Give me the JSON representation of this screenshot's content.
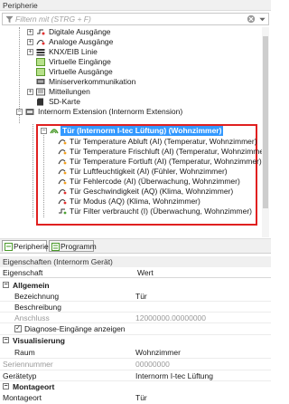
{
  "panel_title": "Peripherie",
  "filter": {
    "placeholder": "Filtern mit (STRG + F)"
  },
  "tree": {
    "items": [
      {
        "label": "Digitale Ausgänge"
      },
      {
        "label": "Analoge Ausgänge"
      },
      {
        "label": "KNX/EIB Linie"
      },
      {
        "label": "Virtuelle Eingänge"
      },
      {
        "label": "Virtuelle Ausgänge"
      },
      {
        "label": "Miniserverkommunikation"
      },
      {
        "label": "Mitteilungen"
      },
      {
        "label": "SD-Karte"
      },
      {
        "label": "Internorm Extension (Internorm Extension)"
      }
    ],
    "selected": "Tür (Internorm I-tec Lüftung) (Wohnzimmer)",
    "children": [
      {
        "label": "Tür Temperature Abluft (AI) (Temperatur, Wohnzimmer)"
      },
      {
        "label": "Tür Temperature Frischluft (AI) (Temperatur, Wohnzimmer)"
      },
      {
        "label": "Tür Temperature Fortluft (AI) (Temperatur, Wohnzimmer)"
      },
      {
        "label": "Tür Luftfeuchtigkeit (AI) (Fühler, Wohnzimmer)"
      },
      {
        "label": "Tür Fehlercode (AI) (Überwachung, Wohnzimmer)"
      },
      {
        "label": "Tür Geschwindigkeit (AQ) (Klima, Wohnzimmer)"
      },
      {
        "label": "Tür Modus (AQ) (Klima, Wohnzimmer)"
      },
      {
        "label": "Tür Filter verbraucht (I) (Überwachung, Wohnzimmer)"
      }
    ]
  },
  "tabs": [
    "Peripherie",
    "Programm"
  ],
  "properties": {
    "title": "Eigenschaften (Internorm Gerät)",
    "col_name": "Eigenschaft",
    "col_value": "Wert",
    "rows": [
      {
        "name": "Allgemein"
      },
      {
        "name": "Bezeichnung",
        "value": "Tür"
      },
      {
        "name": "Beschreibung",
        "value": ""
      },
      {
        "name": "Anschluss",
        "value": "12000000.00000000"
      },
      {
        "name": "Diagnose-Eingänge anzeigen",
        "value": "✓"
      },
      {
        "name": "Visualisierung"
      },
      {
        "name": "Raum",
        "value": "Wohnzimmer"
      },
      {
        "name": "Seriennummer",
        "value": "00000000"
      },
      {
        "name": "Gerätetyp",
        "value": "Internorm I-tec Lüftung"
      },
      {
        "name": "Montageort"
      },
      {
        "name": "Montageort",
        "value": "Tür"
      }
    ]
  },
  "colors": {
    "selection": "#3399ff",
    "highlight_box": "#e02020"
  }
}
